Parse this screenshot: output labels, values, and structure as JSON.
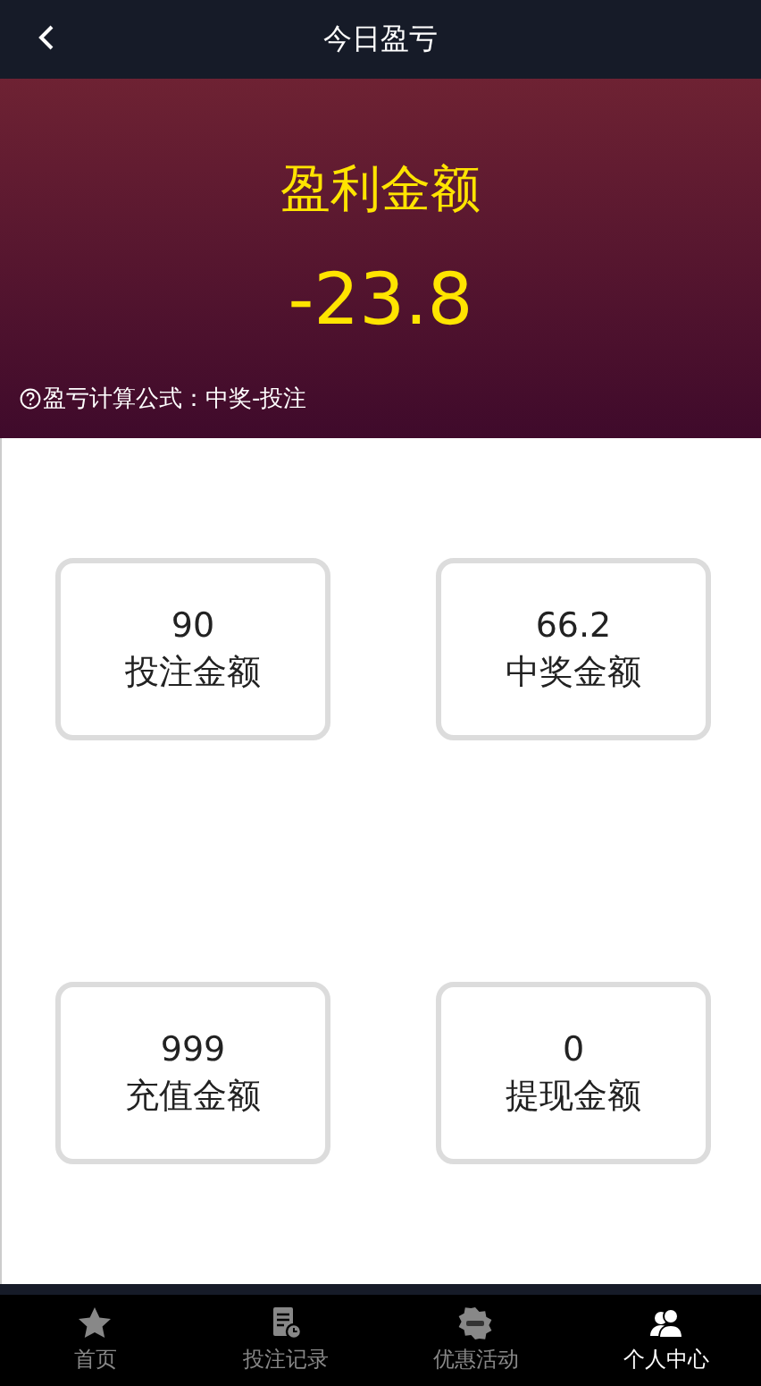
{
  "header": {
    "title": "今日盈亏"
  },
  "summary": {
    "label": "盈利金额",
    "value": "-23.8",
    "formula": "盈亏计算公式：中奖-投注"
  },
  "stats": [
    {
      "value": "90",
      "label": "投注金额"
    },
    {
      "value": "66.2",
      "label": "中奖金额"
    },
    {
      "value": "999",
      "label": "充值金额"
    },
    {
      "value": "0",
      "label": "提现金额"
    }
  ],
  "nav": [
    {
      "kind": "star",
      "label": "首页",
      "selected": false
    },
    {
      "kind": "record",
      "label": "投注记录",
      "selected": false
    },
    {
      "kind": "hot",
      "label": "优惠活动",
      "selected": false
    },
    {
      "kind": "user",
      "label": "个人中心",
      "selected": true
    }
  ]
}
